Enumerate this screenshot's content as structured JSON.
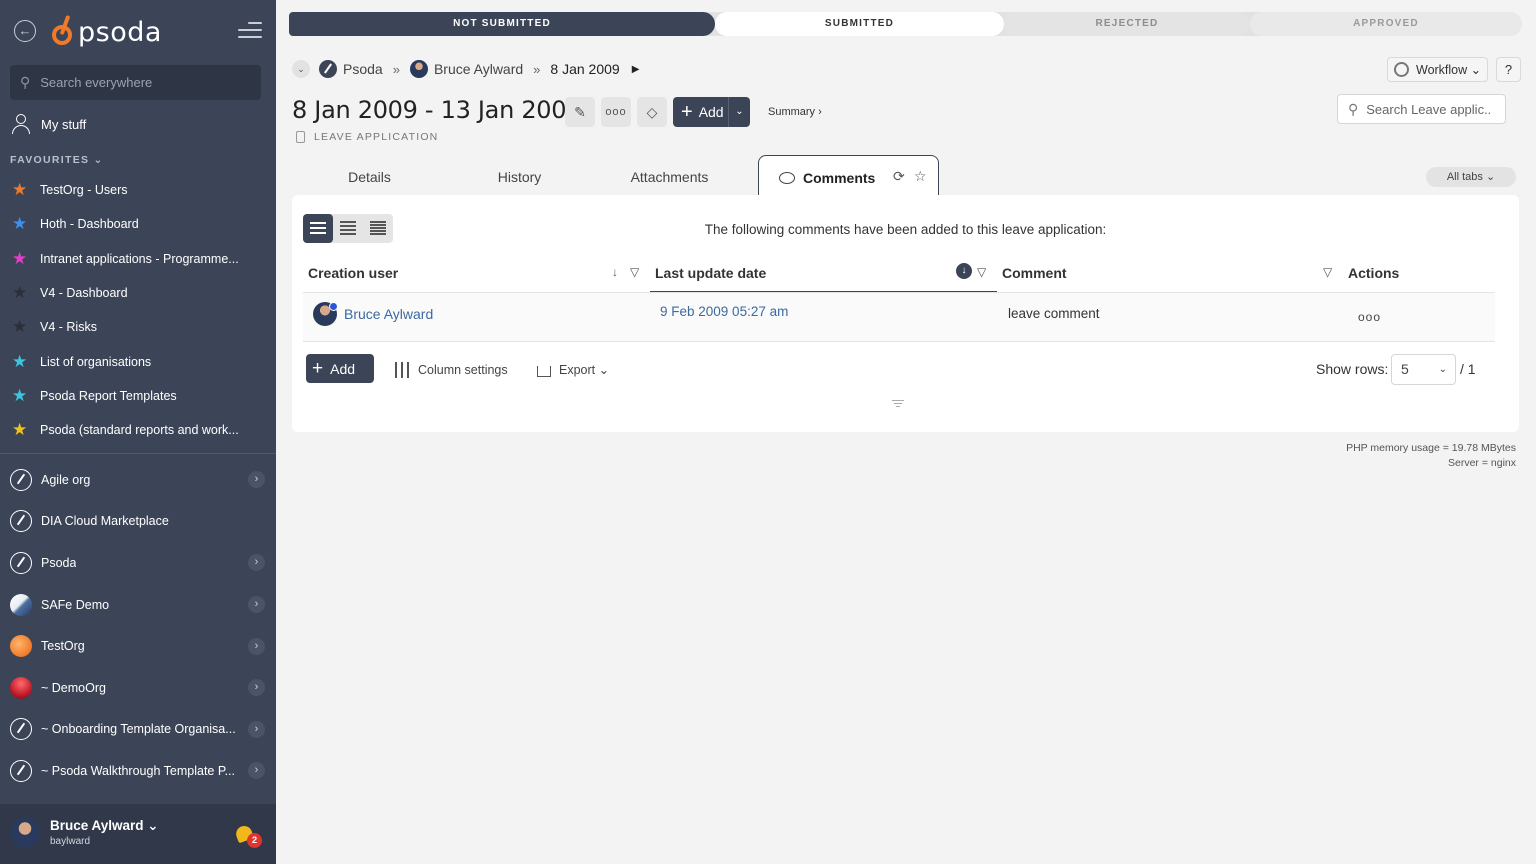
{
  "sidebar": {
    "logo_text": "psoda",
    "search_placeholder": "Search everywhere",
    "my_stuff": "My stuff",
    "favourites_heading": "FAVOURITES",
    "favourites": [
      {
        "label": "TestOrg - Users",
        "color": "#f07a2a"
      },
      {
        "label": "Hoth - Dashboard",
        "color": "#3d8ef0"
      },
      {
        "label": "Intranet applications - Programme...",
        "color": "#e040c8"
      },
      {
        "label": "V4 - Dashboard",
        "color": "#2a2f3a"
      },
      {
        "label": "V4 - Risks",
        "color": "#2a2f3a"
      },
      {
        "label": "List of organisations",
        "color": "#3bc6e0"
      },
      {
        "label": "Psoda Report Templates",
        "color": "#3bc6e0"
      },
      {
        "label": "Psoda (standard reports and work...",
        "color": "#f1c21b"
      }
    ],
    "organisations": [
      {
        "label": "Agile org",
        "icon": "psoda",
        "expandable": true
      },
      {
        "label": "DIA Cloud Marketplace",
        "icon": "psoda",
        "expandable": false
      },
      {
        "label": "Psoda",
        "icon": "psoda",
        "expandable": true
      },
      {
        "label": "SAFe Demo",
        "icon": "safe",
        "expandable": true
      },
      {
        "label": "TestOrg",
        "icon": "test",
        "expandable": true
      },
      {
        "label": "~ DemoOrg",
        "icon": "demo",
        "expandable": true
      },
      {
        "label": "~ Onboarding Template Organisa...",
        "icon": "psoda",
        "expandable": true
      },
      {
        "label": "~ Psoda Walkthrough Template P...",
        "icon": "psoda",
        "expandable": true
      }
    ],
    "user": {
      "name": "Bruce Aylward",
      "login": "baylward",
      "notifications": "2"
    }
  },
  "workflow_stages": {
    "not_submitted": "NOT SUBMITTED",
    "submitted": "SUBMITTED",
    "rejected": "REJECTED",
    "approved": "APPROVED",
    "current": "SUBMITTED"
  },
  "breadcrumb": {
    "items": [
      "Psoda",
      "Bruce Aylward",
      "8 Jan 2009"
    ],
    "separator": "»"
  },
  "header": {
    "workflow_label": "Workflow",
    "help_label": "?",
    "title": "8 Jan 2009 - 13 Jan 2009",
    "subtitle": "LEAVE APPLICATION",
    "add_label": "Add",
    "summary_link": "Summary ›",
    "more_label": "ooo",
    "search_placeholder": "Search Leave applic..."
  },
  "tabs": {
    "items": [
      "Details",
      "History",
      "Attachments",
      "Comments"
    ],
    "active": "Comments",
    "all_tabs_label": "All tabs"
  },
  "comments": {
    "intro": "The following comments have been added to this leave application:",
    "columns": [
      "Creation user",
      "Last update date",
      "Comment",
      "Actions"
    ],
    "rows": [
      {
        "user": "Bruce Aylward",
        "date": "9 Feb 2009 05:27 am",
        "comment": "leave comment",
        "actions": "ooo"
      }
    ],
    "add_label": "Add",
    "column_settings_label": "Column settings",
    "export_label": "Export",
    "show_rows_label": "Show rows:",
    "rows_value": "5",
    "pages_label": "/ 1"
  },
  "footer": {
    "memory": "PHP memory usage = 19.78 MBytes",
    "server": "Server = nginx"
  },
  "colors": {
    "primary": "#3c4557",
    "accent": "#f07a2a",
    "link": "#3b6aa0"
  }
}
